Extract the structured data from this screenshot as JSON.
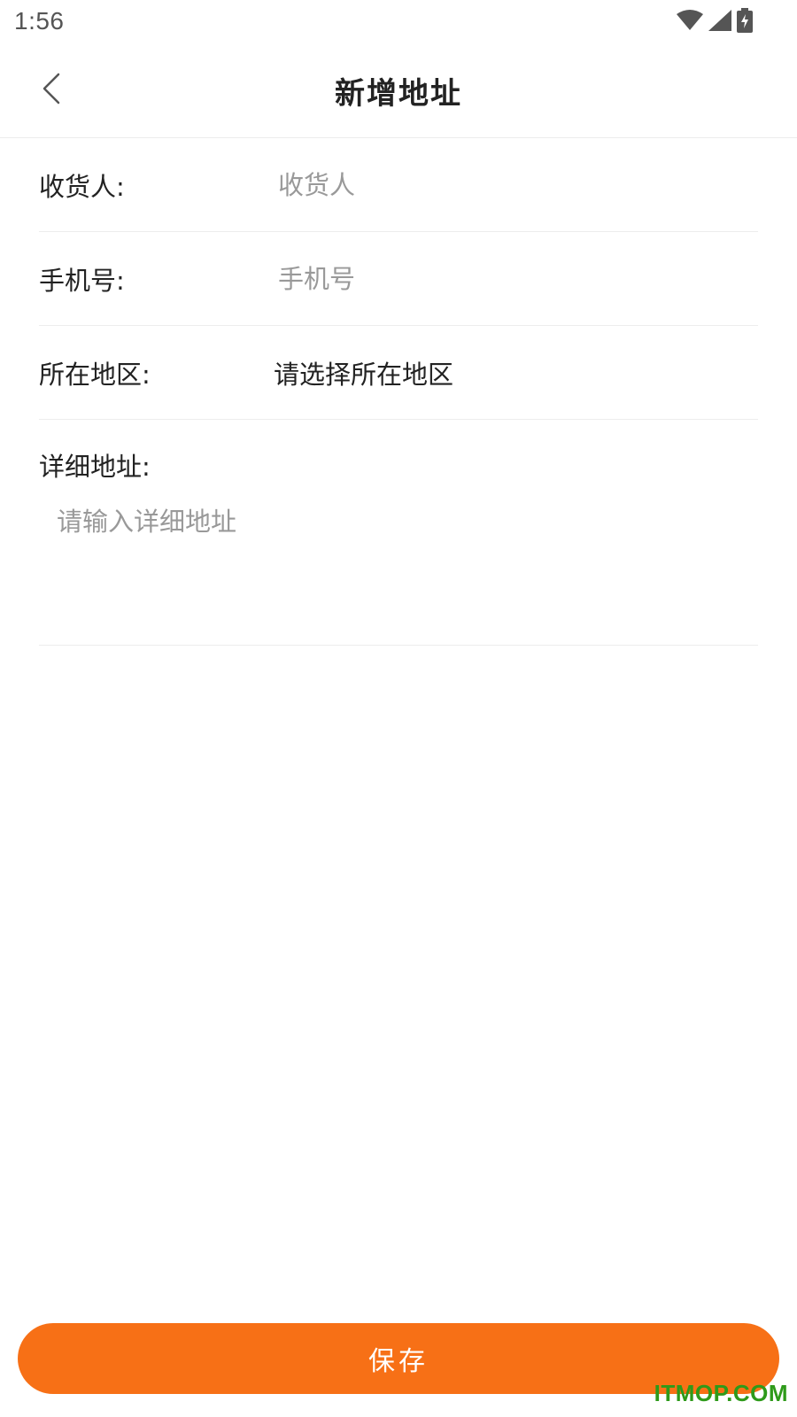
{
  "status_bar": {
    "time": "1:56",
    "icons": [
      "wifi-icon",
      "cellular-signal-icon",
      "battery-charging-icon"
    ]
  },
  "nav": {
    "back_icon": "chevron-left-icon",
    "title": "新增地址"
  },
  "form": {
    "recipient": {
      "label": "收货人:",
      "value": "",
      "placeholder": "收货人"
    },
    "phone": {
      "label": "手机号:",
      "value": "",
      "placeholder": "手机号"
    },
    "region": {
      "label": "所在地区:",
      "value": "请选择所在地区"
    },
    "detail": {
      "label": "详细地址:",
      "value": "",
      "placeholder": "请输入详细地址"
    }
  },
  "save_label": "保存",
  "watermark": "ITMOP.COM",
  "colors": {
    "accent": "#f77016",
    "text": "#222222",
    "placeholder": "#999999",
    "divider": "#ededed",
    "watermark": "#2e9a1a"
  }
}
